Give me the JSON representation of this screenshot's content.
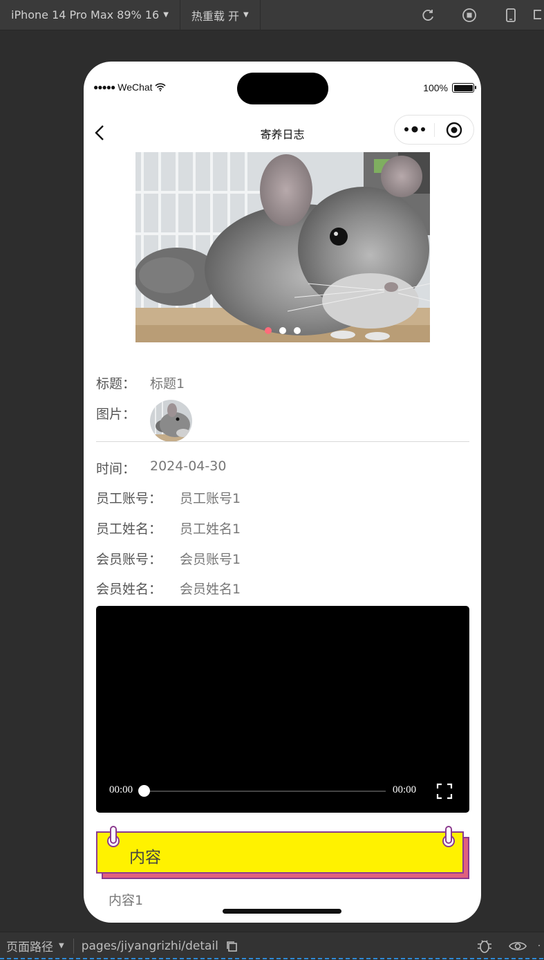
{
  "toolbar": {
    "device": "iPhone 14 Pro Max 89% 16",
    "hot_reload": "热重载 开"
  },
  "status": {
    "carrier": "WeChat",
    "battery": "100%"
  },
  "nav": {
    "title": "寄养日志"
  },
  "carousel": {
    "slides": 3,
    "active_index": 0,
    "active_color": "#ff6b7a"
  },
  "detail": {
    "title_label": "标题：",
    "title_value": "标题1",
    "image_label": "图片：",
    "time_label": "时间：",
    "time_value": "2024-04-30",
    "staff_account_label": "员工账号：",
    "staff_account_value": "员工账号1",
    "staff_name_label": "员工姓名：",
    "staff_name_value": "员工姓名1",
    "member_account_label": "会员账号：",
    "member_account_value": "会员账号1",
    "member_name_label": "会员姓名：",
    "member_name_value": "会员姓名1"
  },
  "video": {
    "current_time": "00:00",
    "duration": "00:00"
  },
  "content_section": {
    "heading": "内容",
    "text": "内容1",
    "banner_color": "#fff200",
    "shadow_color": "#e0607e"
  },
  "bottom": {
    "path_label": "页面路径",
    "path": "pages/jiyangrizhi/detail"
  }
}
